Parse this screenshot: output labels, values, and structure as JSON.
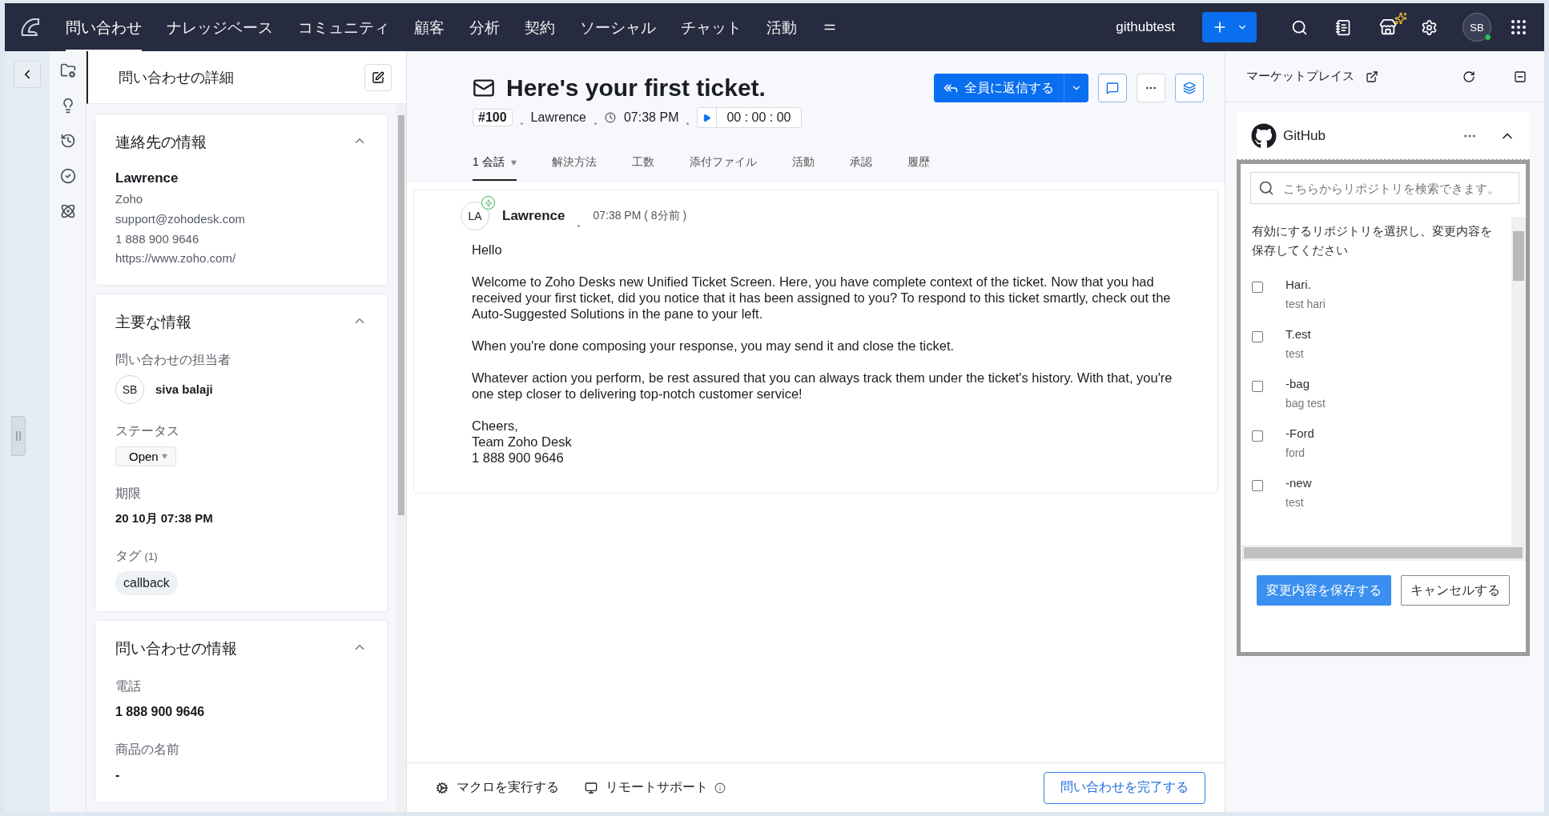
{
  "nav": {
    "items": [
      {
        "label": "問い合わせ",
        "selected": true
      },
      {
        "label": "ナレッジベース",
        "selected": false
      },
      {
        "label": "コミュニティ",
        "selected": false
      },
      {
        "label": "顧客",
        "selected": false
      },
      {
        "label": "分析",
        "selected": false
      },
      {
        "label": "契約",
        "selected": false
      },
      {
        "label": "ソーシャル",
        "selected": false
      },
      {
        "label": "チャット",
        "selected": false
      },
      {
        "label": "活動",
        "selected": false
      }
    ],
    "account": "githubtest",
    "avatar": "SB",
    "avatar_online": true
  },
  "left_panel": {
    "title": "問い合わせの詳細",
    "contact": {
      "title": "連絡先の情報",
      "expanded": true,
      "name": "Lawrence",
      "company": "Zoho",
      "email": "support@zohodesk.com",
      "phone": "1 888 900 9646",
      "website": "https://www.zoho.com/"
    },
    "key_info": {
      "title": "主要な情報",
      "expanded": true,
      "owner_label": "問い合わせの担当者",
      "owner_initials": "SB",
      "owner_name": "siva balaji",
      "status_label": "ステータス",
      "status": "Open",
      "due_label": "期限",
      "due": "20 10月 07:38 PM",
      "tags_label": "タグ",
      "tags_count": "(1)",
      "tags": [
        "callback"
      ]
    },
    "ticket_info": {
      "title": "問い合わせの情報",
      "expanded": true,
      "fields": [
        {
          "label": "電話",
          "value": "1 888 900 9646"
        },
        {
          "label": "商品の名前",
          "value": "-"
        }
      ]
    }
  },
  "ticket": {
    "title": "Here's your first ticket.",
    "number": "#100",
    "contact": "Lawrence",
    "time": "07:38 PM",
    "timer": "00 : 00 : 00",
    "reply_button": "全員に返信する",
    "tabs": [
      {
        "label": "1 会話",
        "selected": true
      },
      {
        "label": "解決方法",
        "selected": false
      },
      {
        "label": "工数",
        "selected": false
      },
      {
        "label": "添付ファイル",
        "selected": false
      },
      {
        "label": "活動",
        "selected": false
      },
      {
        "label": "承認",
        "selected": false
      },
      {
        "label": "履歴",
        "selected": false
      }
    ],
    "message": {
      "initials": "LA",
      "author": "Lawrence",
      "time": "07:38 PM ( 8分前 )",
      "paragraphs": [
        [
          "Hello"
        ],
        [
          "Welcome to Zoho Desks new Unified Ticket Screen. Here, you have complete context of the ticket. Now that you had received your first ticket, did you notice that it has been assigned to you? To respond to this ticket smartly, check out the Auto-Suggested Solutions in the pane to your left."
        ],
        [
          "When you're done composing your response, you may send it and close the ticket."
        ],
        [
          "Whatever action you perform, be rest assured that you can always track them under the ticket's history. With that, you're one step closer to delivering top-notch customer service!"
        ],
        [
          "Cheers,",
          "Team Zoho Desk",
          "1 888 900 9646"
        ]
      ]
    }
  },
  "footer": {
    "macro": "マクロを実行する",
    "remote": "リモートサポート",
    "close_button": "問い合わせを完了する"
  },
  "right_panel": {
    "title": "マーケットプレイス",
    "github": {
      "title": "GitHub",
      "search_placeholder": "こちらからリポジトリを検索できます。",
      "instruction": "有効にするリポジトリを選択し、変更内容を保存してください",
      "repos": [
        {
          "name": "Hari.",
          "description": "test hari",
          "checked": false
        },
        {
          "name": "T.est",
          "description": "test",
          "checked": false
        },
        {
          "name": "-bag",
          "description": "bag test",
          "checked": false
        },
        {
          "name": "-Ford",
          "description": "ford",
          "checked": false
        },
        {
          "name": "-new",
          "description": "test",
          "checked": false
        }
      ],
      "save": "変更内容を保存する",
      "cancel": "キャンセルする"
    }
  }
}
